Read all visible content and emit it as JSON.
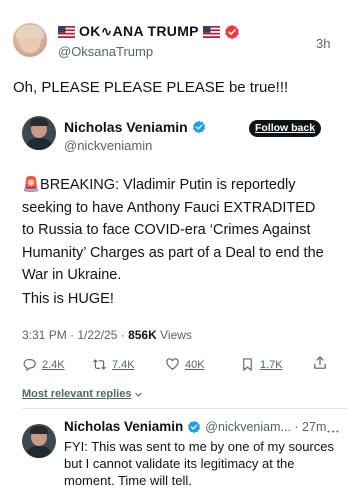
{
  "post": {
    "display_name": "OK∿ANA TRUMP",
    "handle": "@OksanaTrump",
    "time": "3h",
    "text": "Oh, PLEASE PLEASE PLEASE be true!!!"
  },
  "quoted": {
    "name": "Nicholas Veniamin",
    "handle": "@nickveniamin",
    "follow_label": "Follow back",
    "paragraph1": "🚨BREAKING: Vladimir Putin is reportedly seeking to have Anthony Fauci EXTRADITED to Russia to face COVID-era ‘Crimes Against Humanity’ Charges as part of a Deal to end the War in Ukraine.",
    "paragraph2": "This is HUGE!",
    "meta_time": "3:31 PM · 1/22/25 ·",
    "views_count": "856K",
    "views_label": "Views",
    "metrics": {
      "replies": "2.4K",
      "reposts": "7.4K",
      "likes": "40K",
      "bookmarks": "1.7K"
    },
    "sort_label": "Most relevant replies"
  },
  "reply": {
    "name": "Nicholas Veniamin",
    "handle_time": "@nickveniam... · 27m",
    "text": "FYI: This was sent to me by one of my sources but I cannot validate its legitimacy at the moment. Time will tell."
  },
  "colors": {
    "verified": "#1d9bf0",
    "text": "#0f1419",
    "muted": "#536471",
    "follow_bg": "#0f1419"
  }
}
